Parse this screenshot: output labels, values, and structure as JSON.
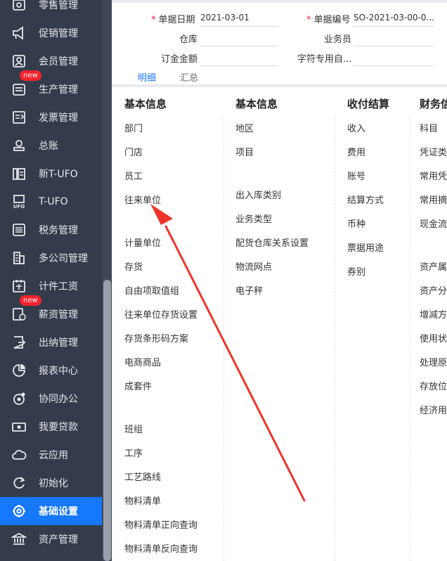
{
  "sidebar": {
    "items": [
      {
        "label": "零售管理",
        "icon": "retail-icon"
      },
      {
        "label": "促销管理",
        "icon": "megaphone-icon"
      },
      {
        "label": "会员管理",
        "icon": "member-icon"
      },
      {
        "label": "生产管理",
        "icon": "production-icon",
        "badge": "new"
      },
      {
        "label": "发票管理",
        "icon": "invoice-icon"
      },
      {
        "label": "总账",
        "icon": "ledger-icon"
      },
      {
        "label": "新T-UFO",
        "icon": "new-tufo-icon"
      },
      {
        "label": "T-UFO",
        "icon": "tufo-icon"
      },
      {
        "label": "税务管理",
        "icon": "tax-icon"
      },
      {
        "label": "多公司管理",
        "icon": "building-icon"
      },
      {
        "label": "计件工资",
        "icon": "piecework-icon"
      },
      {
        "label": "薪资管理",
        "icon": "salary-icon",
        "badge": "new"
      },
      {
        "label": "出纳管理",
        "icon": "cashier-icon"
      },
      {
        "label": "报表中心",
        "icon": "report-icon"
      },
      {
        "label": "协同办公",
        "icon": "collab-icon"
      },
      {
        "label": "我要贷款",
        "icon": "loan-icon"
      },
      {
        "label": "云应用",
        "icon": "cloud-icon"
      },
      {
        "label": "初始化",
        "icon": "init-icon"
      },
      {
        "label": "基础设置",
        "icon": "settings-icon",
        "active": true
      },
      {
        "label": "资产管理",
        "icon": "bank-icon"
      }
    ]
  },
  "form": {
    "date_label": "单据日期",
    "date_value": "2021-03-01",
    "number_label": "单据编号",
    "number_value": "SO-2021-03-00-0...",
    "warehouse_label": "仓库",
    "warehouse_value": "",
    "salesman_label": "业务员",
    "salesman_value": "",
    "deposit_label": "订金金额",
    "deposit_value": "",
    "custom_label": "字符专用自...",
    "custom_value": "",
    "tabs": [
      "明细",
      "汇总"
    ]
  },
  "panel": {
    "columns": [
      {
        "title": "基本信息",
        "items": [
          "部门",
          "门店",
          "员工",
          "往来单位",
          "计量单位",
          "存货",
          "自由项取值组",
          "往来单位存货设置",
          "存货条形码方案",
          "电商商品",
          "成套件",
          "班组",
          "工序",
          "工艺路线",
          "物料清单",
          "物料清单正向查询",
          "物料清单反向查询"
        ]
      },
      {
        "title": "基本信息",
        "items": [
          "地区",
          "项目",
          "出入库类别",
          "业务类型",
          "配货仓库关系设置",
          "物流网点",
          "电子秤"
        ]
      },
      {
        "title": "收付结算",
        "items": [
          "收入",
          "费用",
          "账号",
          "结算方式",
          "币种",
          "票据用途",
          "券别"
        ]
      },
      {
        "title": "财务信",
        "items": [
          "科目",
          "凭证类",
          "常用凭",
          "常用摘",
          "现金流",
          "资产属",
          "资产分",
          "增减方",
          "使用状",
          "处理原",
          "存放位",
          "经济用"
        ]
      }
    ]
  },
  "annotation": {
    "color": "#f0342a"
  }
}
